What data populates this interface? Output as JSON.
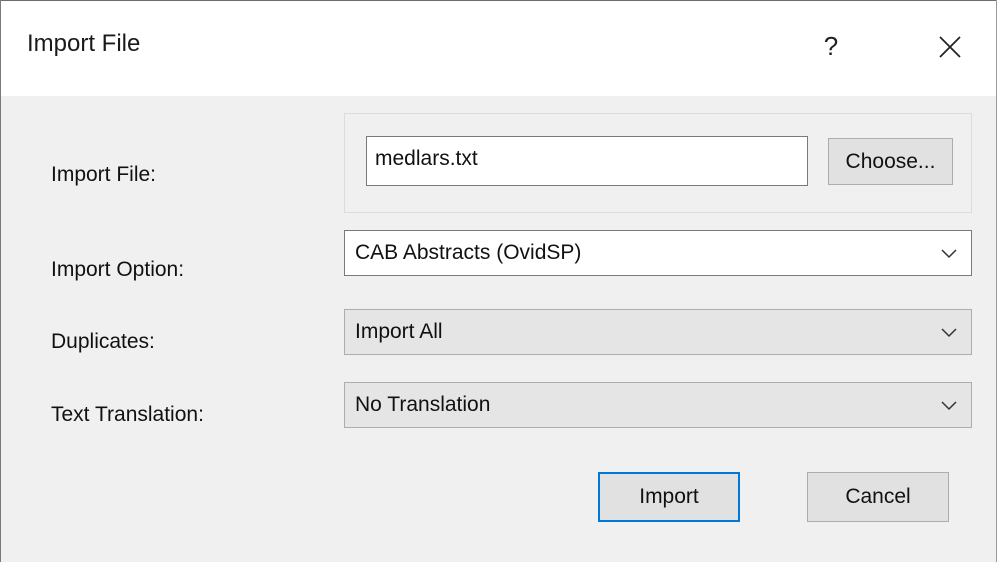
{
  "window": {
    "title": "Import File",
    "help_label": "?",
    "close_icon": "close-icon"
  },
  "form": {
    "import_file": {
      "label": "Import File:",
      "value": "medlars.txt",
      "choose_label": "Choose..."
    },
    "import_option": {
      "label": "Import Option:",
      "selected": "CAB Abstracts (OvidSP)"
    },
    "duplicates": {
      "label": "Duplicates:",
      "selected": "Import All"
    },
    "text_translation": {
      "label": "Text Translation:",
      "selected": "No Translation"
    }
  },
  "buttons": {
    "import_label": "Import",
    "cancel_label": "Cancel"
  },
  "colors": {
    "focus_accent": "#0078d7",
    "dialog_bg": "#f0f0f0",
    "button_bg": "#e1e1e1"
  }
}
